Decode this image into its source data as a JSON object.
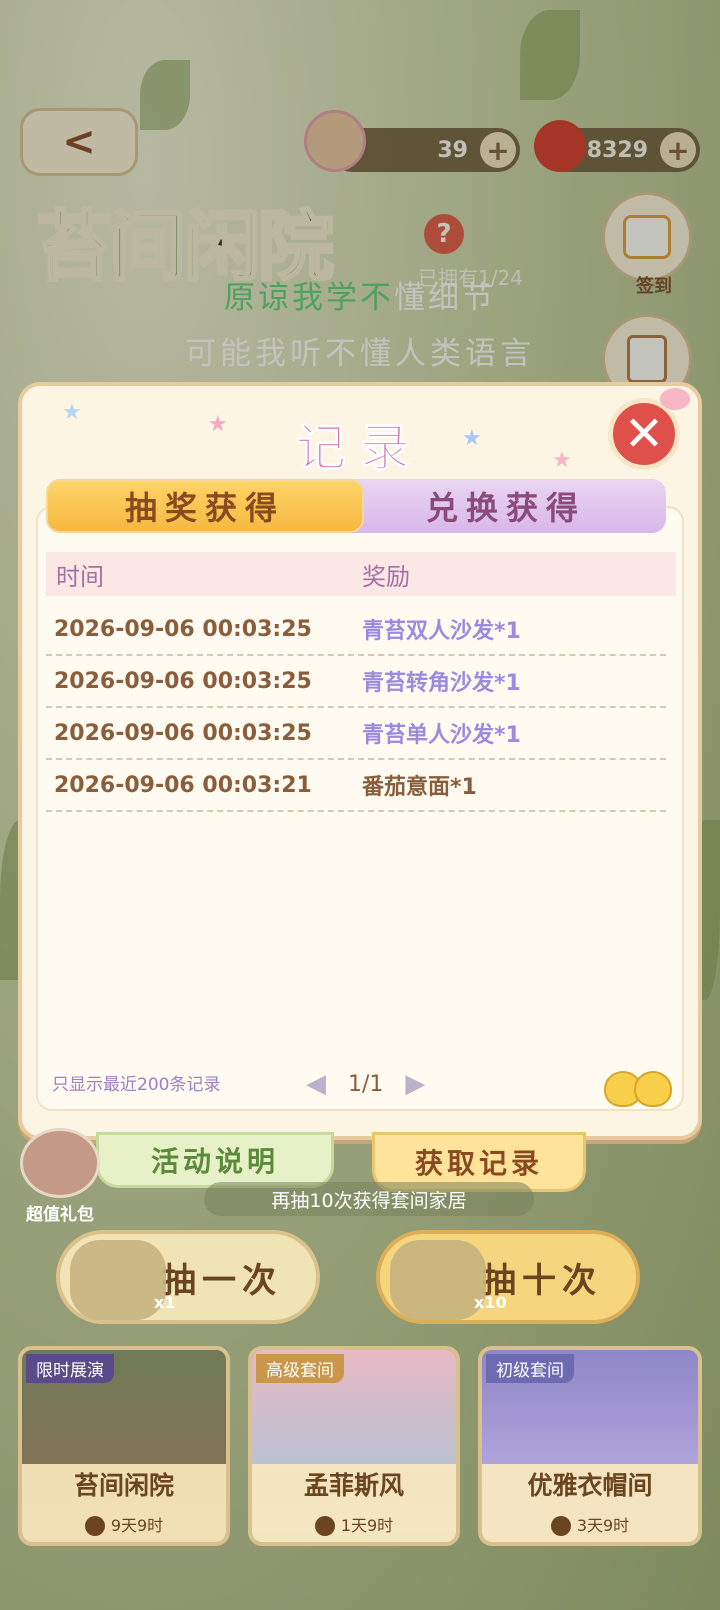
{
  "header": {
    "back_label": "<",
    "resource_tokens": "39",
    "resource_cherries": "8329",
    "plus": "+",
    "title_part1": "苔间",
    "title_part2": "闲院",
    "help": "?",
    "owned_text": "已拥有1/24",
    "signin_label": "签到"
  },
  "subtitle": {
    "line1_green": "原谅我学不",
    "line1_white": "懂细节",
    "line2": "可能我听不懂人类语言"
  },
  "modal": {
    "title": "记录",
    "close": "✕",
    "tabs": [
      {
        "label": "抽奖获得",
        "active": true
      },
      {
        "label": "兑换获得",
        "active": false
      }
    ],
    "columns": {
      "time": "时间",
      "reward": "奖励"
    },
    "rows": [
      {
        "time": "2026-09-06  00:03:25",
        "reward": "青苔双人沙发*1",
        "color": "purple"
      },
      {
        "time": "2026-09-06  00:03:25",
        "reward": "青苔转角沙发*1",
        "color": "purple"
      },
      {
        "time": "2026-09-06  00:03:25",
        "reward": "青苔单人沙发*1",
        "color": "purple"
      },
      {
        "time": "2026-09-06  00:03:21",
        "reward": "番茄意面*1",
        "color": "brown"
      }
    ],
    "footer_note": "只显示最近200条记录",
    "pager": {
      "prev": "◀",
      "page": "1/1",
      "next": "▶"
    }
  },
  "bottom": {
    "tab_rules": "活动说明",
    "tab_records": "获取记录",
    "gift_label": "超值礼包",
    "hint": "再抽10次获得套间家居",
    "draw_one": "抽一次",
    "draw_one_count": "x1",
    "draw_ten": "抽十次",
    "draw_ten_count": "x10",
    "cards": [
      {
        "tag": "限时展演",
        "name": "苔间闲院",
        "timer": "9天9时"
      },
      {
        "tag": "高级套间",
        "name": "孟菲斯风",
        "timer": "1天9时"
      },
      {
        "tag": "初级套间",
        "name": "优雅衣帽间",
        "timer": "3天9时"
      }
    ]
  }
}
